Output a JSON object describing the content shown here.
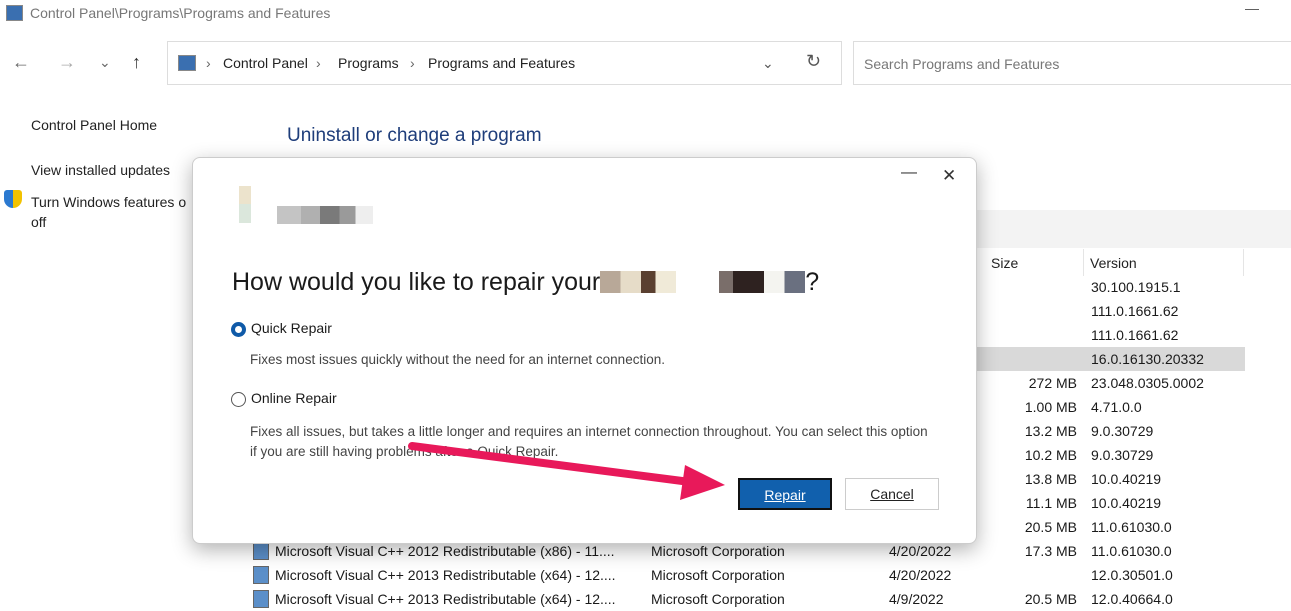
{
  "window": {
    "title": "Control Panel\\Programs\\Programs and Features",
    "minimize": "—"
  },
  "nav": {
    "back": "←",
    "forward": "→",
    "recent": "⌄",
    "up": "↑"
  },
  "address": {
    "crumbs": [
      "Control Panel",
      "Programs",
      "Programs and Features"
    ],
    "sep": "›",
    "dropdown": "⌄",
    "refresh": "↻"
  },
  "search": {
    "placeholder": "Search Programs and Features"
  },
  "sidebar": {
    "items": [
      {
        "label": "Control Panel Home"
      },
      {
        "label": "View installed updates"
      },
      {
        "label": "Turn Windows features on or off",
        "line1": "Turn Windows features o",
        "line2": "off"
      }
    ]
  },
  "main": {
    "heading": "Uninstall or change a program"
  },
  "table": {
    "headers": {
      "size": "Size",
      "version": "Version"
    },
    "rows": [
      {
        "name": "",
        "publisher": "",
        "date": "",
        "size": "",
        "version": "30.100.1915.1"
      },
      {
        "name": "",
        "publisher": "",
        "date": "",
        "size": "",
        "version": "111.0.1661.62"
      },
      {
        "name": "",
        "publisher": "",
        "date": "",
        "size": "",
        "version": "111.0.1661.62"
      },
      {
        "name": "",
        "publisher": "",
        "date": "",
        "size": "",
        "version": "16.0.16130.20332",
        "selected": true
      },
      {
        "name": "",
        "publisher": "",
        "date": "",
        "size": "272 MB",
        "version": "23.048.0305.0002"
      },
      {
        "name": "",
        "publisher": "",
        "date": "",
        "size": "1.00 MB",
        "version": "4.71.0.0"
      },
      {
        "name": "",
        "publisher": "",
        "date": "",
        "size": "13.2 MB",
        "version": "9.0.30729"
      },
      {
        "name": "",
        "publisher": "",
        "date": "",
        "size": "10.2 MB",
        "version": "9.0.30729"
      },
      {
        "name": "",
        "publisher": "",
        "date": "",
        "size": "13.8 MB",
        "version": "10.0.40219"
      },
      {
        "name": "",
        "publisher": "",
        "date": "",
        "size": "11.1 MB",
        "version": "10.0.40219"
      },
      {
        "name": "",
        "publisher": "",
        "date": "",
        "size": "20.5 MB",
        "version": "11.0.61030.0"
      },
      {
        "name": "Microsoft Visual C++ 2012 Redistributable (x86) - 11....",
        "publisher": "Microsoft Corporation",
        "date": "4/20/2022",
        "size": "17.3 MB",
        "version": "11.0.61030.0"
      },
      {
        "name": "Microsoft Visual C++ 2013 Redistributable (x64) - 12....",
        "publisher": "Microsoft Corporation",
        "date": "4/20/2022",
        "size": "",
        "version": "12.0.30501.0"
      },
      {
        "name": "Microsoft Visual C++ 2013 Redistributable (x64) - 12....",
        "publisher": "Microsoft Corporation",
        "date": "4/9/2022",
        "size": "20.5 MB",
        "version": "12.0.40664.0"
      }
    ]
  },
  "dialog": {
    "minimize": "—",
    "close": "✕",
    "question": "How would you like to repair your",
    "question_end": "?",
    "options": [
      {
        "label": "Quick Repair",
        "desc": "Fixes most issues quickly without the need for an internet connection.",
        "selected": true
      },
      {
        "label": "Online Repair",
        "desc": "Fixes all issues, but takes a little longer and requires an internet connection throughout. You can select this option if you are still having problems after a Quick Repair.",
        "selected": false
      }
    ],
    "repair": "Repair",
    "cancel": "Cancel"
  },
  "annotation": {
    "arrow_color": "#e8195a"
  }
}
